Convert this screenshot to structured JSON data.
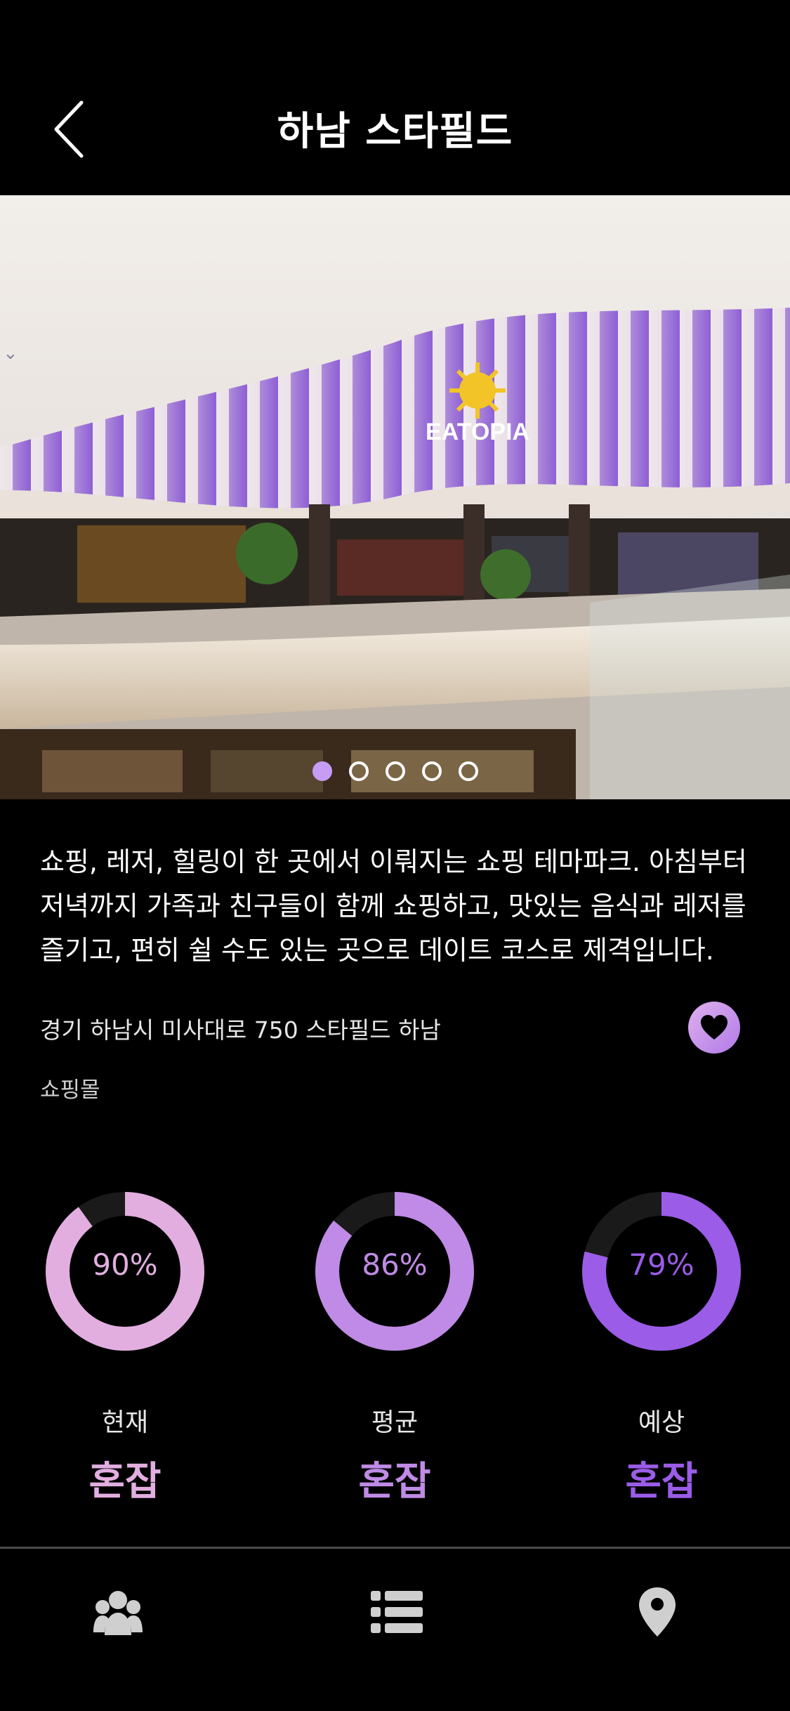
{
  "header": {
    "title": "하남 스타필드"
  },
  "hero": {
    "sign_text": "EATOPIA",
    "slide_count": 5,
    "active_slide": 1
  },
  "place": {
    "description": "쇼핑, 레저, 힐링이 한 곳에서 이뤄지는 쇼핑 테마파크. 아침부터 저녁까지 가족과 친구들이 함께 쇼핑하고, 맛있는 음식과 레저를 즐기고, 편히 쉴 수도 있는 곳으로 데이트 코스로 제격입니다.",
    "address": "경기 하남시 미사대로 750 스타필드 하남",
    "category": "쇼핑몰"
  },
  "stats": [
    {
      "percent": "90%",
      "value": 90,
      "label": "현재",
      "status": "혼잡",
      "color": "#e2aee0"
    },
    {
      "percent": "86%",
      "value": 86,
      "label": "평균",
      "status": "혼잡",
      "color": "#bf8be6"
    },
    {
      "percent": "79%",
      "value": 79,
      "label": "예상",
      "status": "혼잡",
      "color": "#9b5ce8"
    }
  ],
  "tabbar": {
    "icons": [
      "users-icon",
      "list-icon",
      "map-pin-icon"
    ]
  }
}
